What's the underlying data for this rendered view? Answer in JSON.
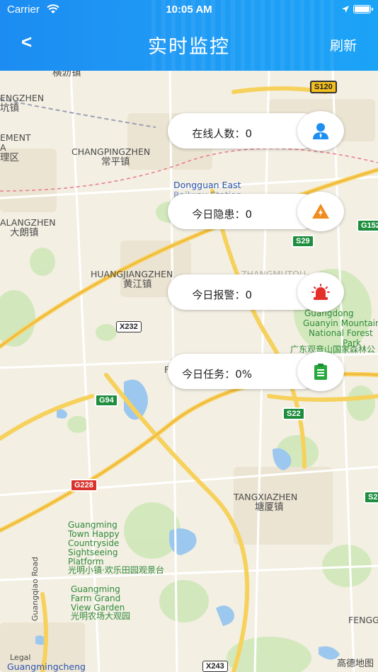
{
  "status_bar": {
    "carrier": "Carrier",
    "time": "10:05 AM"
  },
  "header": {
    "back_label": "<",
    "title": "实时监控",
    "refresh_label": "刷新"
  },
  "colors": {
    "header_blue": "#1f9bf5",
    "user_icon": "#1f8ef1",
    "hazard_icon": "#f08c1d",
    "alarm_icon": "#e3302b",
    "task_icon": "#26a83c"
  },
  "stats": [
    {
      "label": "在线人数",
      "value": "0",
      "icon": "user-icon"
    },
    {
      "label": "今日隐患",
      "value": "0",
      "icon": "hazard-warning-icon"
    },
    {
      "label": "今日报警",
      "value": "0",
      "icon": "alarm-siren-icon"
    },
    {
      "label": "今日任务",
      "value": "0%",
      "icon": "task-clipboard-icon"
    }
  ],
  "map": {
    "labels": {
      "hengli": "横沥镇",
      "engzhen": "ENGZHEN",
      "keng": "坑镇",
      "ement": "EMENT",
      "a": "A",
      "liqu": "理区",
      "changping_en": "CHANGPINGZHEN",
      "changping_cn": "常平镇",
      "dongguan_east": "Dongguan East",
      "railway": "Railway Station",
      "alangzhen": "ALANGZHEN",
      "dalang": "大朗镇",
      "huangjiang_en": "HUANGJIANGZHEN",
      "huangjiang_cn": "黄江镇",
      "zhangmutou": "ZHANGMUTOU",
      "guangdong": "Guangdong",
      "guanyin_mountain": "Guanyin Mountain",
      "national_forest": "National Forest",
      "park": "Park",
      "guanyin_cn": "广东观音山国家森林公",
      "f": "F",
      "tangxia_en": "TANGXIAZHEN",
      "tangxia_cn": "塘厦镇",
      "guangming_town": "Guangming",
      "town_happy": "Town Happy",
      "countryside": "Countryside",
      "sightseeing": "Sightseeing",
      "platform": "Platform",
      "guangming_cn": "光明小镇·欢乐田园观景台",
      "farm_line1": "Guangming",
      "farm_line2": "Farm Grand",
      "farm_line3": "View Garden",
      "farm_cn": "光明农场大观园",
      "guangqiao_road": "Guangqiao Road",
      "guangmingcheng": "Guangmingcheng",
      "legal": "Legal",
      "fengg": "FENGG",
      "amap": "高德地图"
    },
    "shields": {
      "s120": "S120",
      "g1523": "G152",
      "s29": "S29",
      "x232": "X232",
      "g94": "G94",
      "s22": "S22",
      "g228": "G228",
      "s2": "S2",
      "x243": "X243"
    }
  }
}
